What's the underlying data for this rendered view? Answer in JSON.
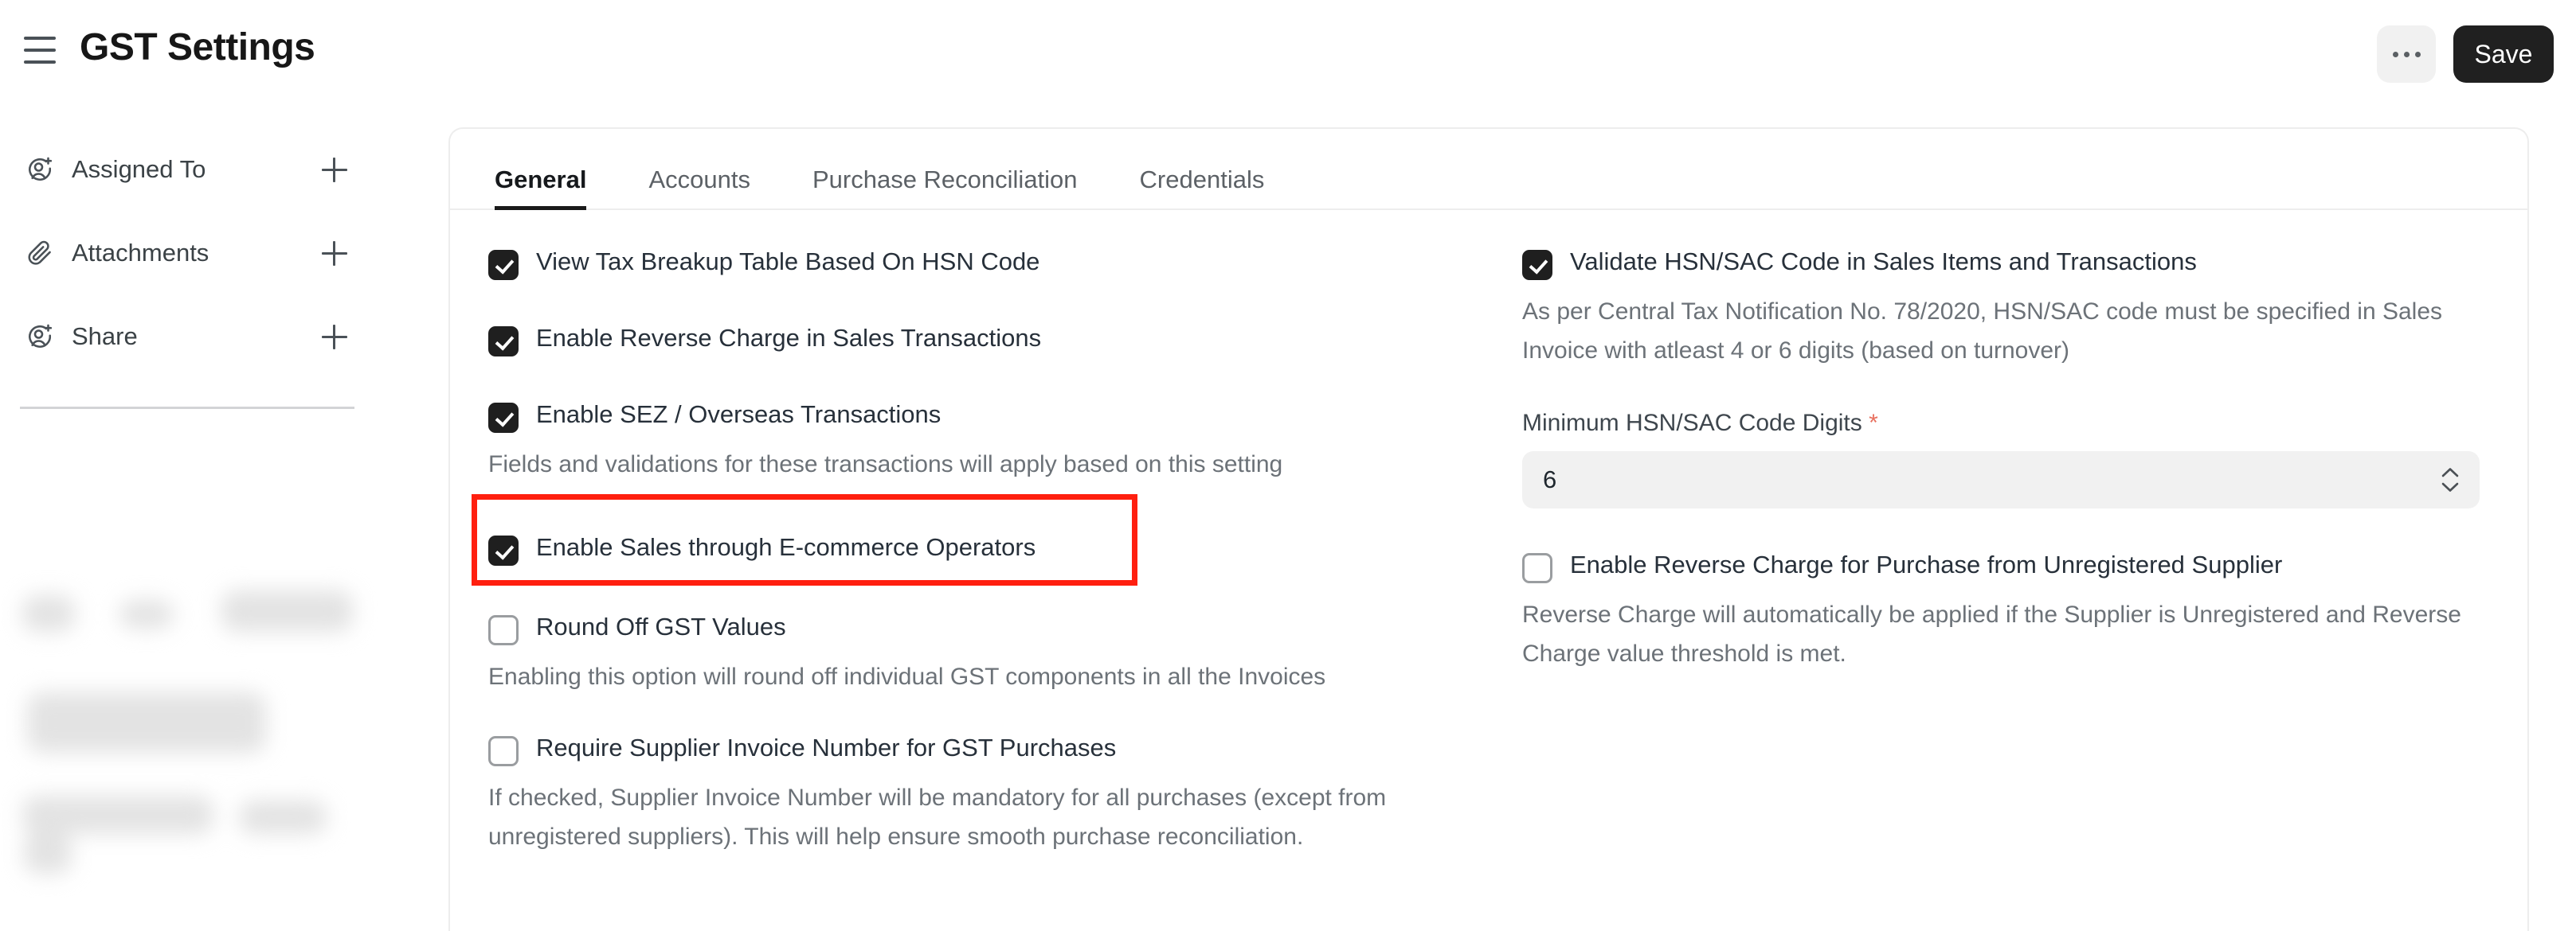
{
  "header": {
    "menu_icon": "hamburger-icon",
    "title": "GST Settings",
    "more_label": "…",
    "save_label": "Save"
  },
  "sidebar": {
    "items": [
      {
        "icon": "assign-user-icon",
        "label": "Assigned To",
        "action": "plus-icon"
      },
      {
        "icon": "paperclip-icon",
        "label": "Attachments",
        "action": "plus-icon"
      },
      {
        "icon": "share-user-icon",
        "label": "Share",
        "action": "plus-icon"
      }
    ]
  },
  "main": {
    "tabs": [
      {
        "label": "General",
        "active": true
      },
      {
        "label": "Accounts",
        "active": false
      },
      {
        "label": "Purchase Reconciliation",
        "active": false
      },
      {
        "label": "Credentials",
        "active": false
      }
    ],
    "left_column": {
      "view_tax_breakup": {
        "label": "View Tax Breakup Table Based On HSN Code",
        "checked": true
      },
      "reverse_charge_sales": {
        "label": "Enable Reverse Charge in Sales Transactions",
        "checked": true
      },
      "sez_overseas": {
        "label": "Enable SEZ / Overseas Transactions",
        "checked": true
      },
      "sez_overseas_desc": "Fields and validations for these transactions will apply based on this setting",
      "ecommerce_operators": {
        "label": "Enable Sales through E-commerce Operators",
        "checked": true
      },
      "round_off": {
        "label": "Round Off GST Values",
        "checked": false
      },
      "round_off_desc": "Enabling this option will round off individual GST components in all the Invoices",
      "require_supplier_invoice": {
        "label": "Require Supplier Invoice Number for GST Purchases",
        "checked": false
      },
      "require_supplier_invoice_desc": "If checked, Supplier Invoice Number will be mandatory for all purchases (except from unregistered suppliers). This will help ensure smooth purchase reconciliation."
    },
    "right_column": {
      "validate_hsn": {
        "label": "Validate HSN/SAC Code in Sales Items and Transactions",
        "checked": true
      },
      "validate_hsn_desc": "As per Central Tax Notification No. 78/2020, HSN/SAC code must be specified in Sales Invoice with atleast 4 or 6 digits (based on turnover)",
      "min_digits_label": "Minimum HSN/SAC Code Digits",
      "min_digits_required_mark": "*",
      "min_digits_value": "6",
      "reverse_charge_unregistered": {
        "label": "Enable Reverse Charge for Purchase from Unregistered Supplier",
        "checked": false
      },
      "reverse_charge_unregistered_desc": "Reverse Charge will automatically be applied if the Supplier is Unregistered and Reverse Charge value threshold is met."
    }
  },
  "annotation": {
    "highlight_color": "#ff1f0f",
    "target": "Enable Sales through E-commerce Operators"
  }
}
